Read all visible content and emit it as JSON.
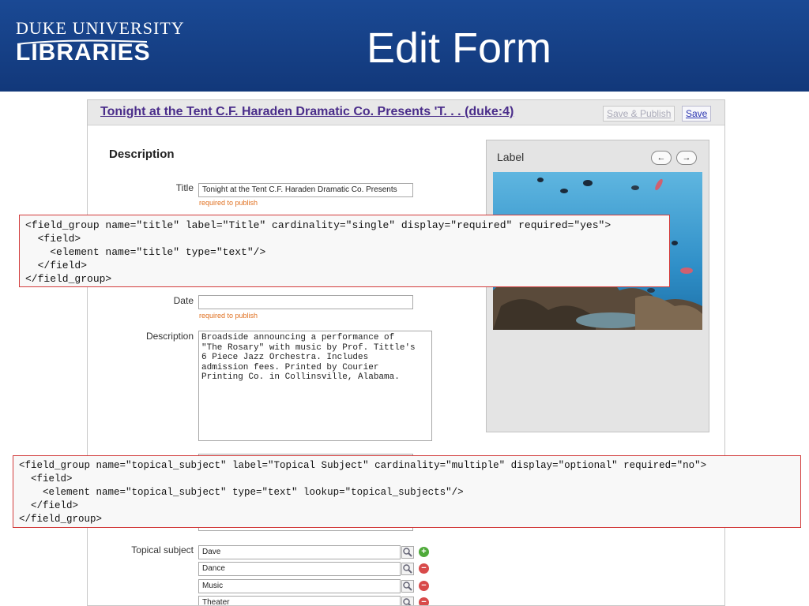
{
  "slide": {
    "logo_line1": "DUKE UNIVERSITY",
    "logo_line2": "LIBRARIES",
    "title": "Edit Form"
  },
  "form": {
    "record_title": "Tonight at the Tent C.F. Haraden Dramatic Co. Presents 'T. . . (duke:4)",
    "save_publish_label": "Save & Publish",
    "save_label": "Save",
    "section_heading": "Description",
    "title_field": {
      "label": "Title",
      "value": "Tonight at the Tent C.F. Haraden Dramatic Co. Presents",
      "note": "required to publish"
    },
    "date_field": {
      "label": "Date",
      "value": "",
      "note": "required to publish"
    },
    "description_field": {
      "label": "Description",
      "lines": [
        "Broadside announcing a performance of",
        "\"The Rosary\" with music by Prof. Tittle's",
        "6 Piece Jazz Orchestra. Includes",
        "admission fees. Printed by Courier",
        "Printing Co. in Collinsville, Alabama."
      ]
    },
    "topical_subject": {
      "label": "Topical subject",
      "values": [
        "Dave",
        "Dance",
        "Music",
        "Theater"
      ]
    }
  },
  "image_panel": {
    "label": "Label",
    "prev_icon": "arrow-left-icon",
    "next_icon": "arrow-right-icon"
  },
  "xml_title": {
    "lines": [
      "<field_group name=\"title\" label=\"Title\" cardinality=\"single\" display=\"required\" required=\"yes\">",
      "  <field>",
      "    <element name=\"title\" type=\"text\"/>",
      "  </field>",
      "</field_group>"
    ]
  },
  "xml_topical": {
    "lines": [
      "<field_group name=\"topical_subject\" label=\"Topical Subject\" cardinality=\"multiple\" display=\"optional\" required=\"no\">",
      "  <field>",
      "    <element name=\"topical_subject\" type=\"text\" lookup=\"topical_subjects\"/>",
      "  </field>",
      "</field_group>"
    ]
  },
  "colors": {
    "header_blue": "#17438a",
    "record_title": "#4a2d8a",
    "required_note": "#e07020",
    "xml_border": "#d23b3b"
  }
}
